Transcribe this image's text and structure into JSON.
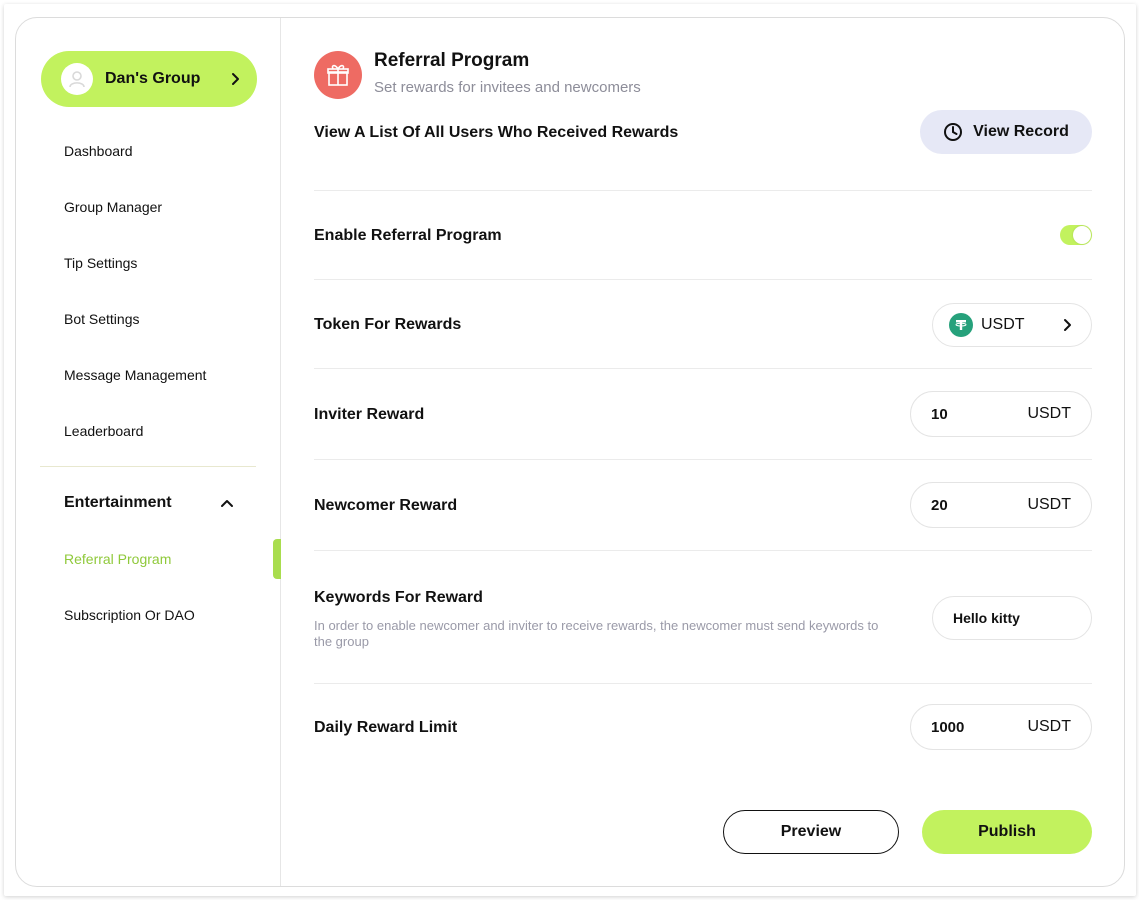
{
  "sidebar": {
    "group": {
      "name": "Dan's Group",
      "avatar_icon": "user-face-icon"
    },
    "items": [
      {
        "label": "Dashboard"
      },
      {
        "label": "Group Manager"
      },
      {
        "label": "Tip Settings"
      },
      {
        "label": "Bot Settings"
      },
      {
        "label": "Message Management"
      },
      {
        "label": "Leaderboard"
      }
    ],
    "section": {
      "title": "Entertainment",
      "expanded": true,
      "items": [
        {
          "label": "Referral Program",
          "active": true
        },
        {
          "label": "Subscription Or DAO"
        }
      ]
    }
  },
  "header": {
    "icon": "gift-icon",
    "title": "Referral Program",
    "subtitle": "Set rewards for invitees and newcomers"
  },
  "record_row": {
    "label": "View A List Of All Users Who Received Rewards",
    "button_label": "View Record"
  },
  "enable_row": {
    "label": "Enable Referral Program",
    "enabled": true
  },
  "token_row": {
    "label": "Token For Rewards",
    "token": "USDT",
    "token_icon": "tether-icon"
  },
  "inviter_row": {
    "label": "Inviter Reward",
    "value": "10",
    "unit": "USDT"
  },
  "newcomer_row": {
    "label": "Newcomer Reward",
    "value": "20",
    "unit": "USDT"
  },
  "keywords_row": {
    "label": "Keywords For Reward",
    "description": "In order to enable newcomer and inviter to receive rewards, the newcomer must send keywords to the group",
    "value": "Hello kitty"
  },
  "daily_row": {
    "label": "Daily Reward Limit",
    "value": "1000",
    "unit": "USDT"
  },
  "actions": {
    "preview_label": "Preview",
    "publish_label": "Publish"
  },
  "colors": {
    "accent": "#c2f25e",
    "accent_text": "#8fc93a",
    "header_icon_bg": "#ee6b63",
    "view_record_bg": "#e6e8f6",
    "tether": "#26a17b"
  }
}
